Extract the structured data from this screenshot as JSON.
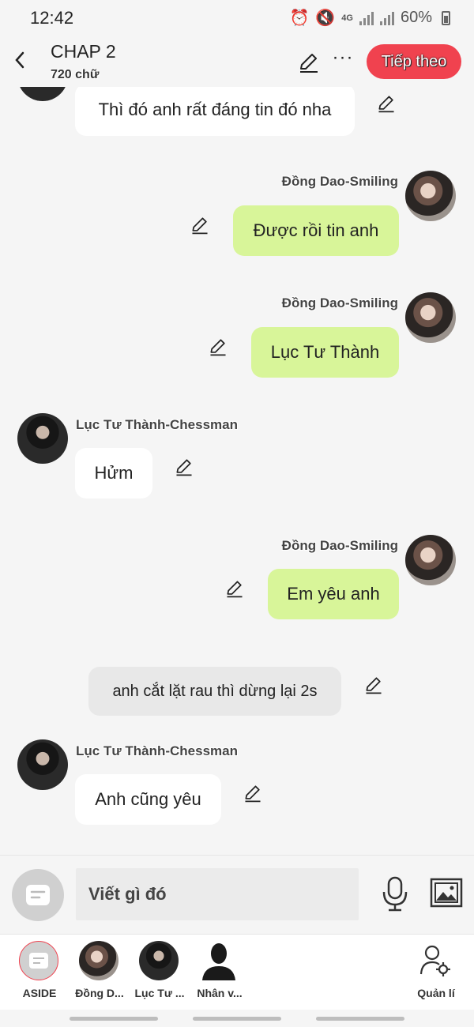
{
  "status_bar": {
    "time": "12:42",
    "network": "4G",
    "battery": "60%"
  },
  "header": {
    "title": "CHAP 2",
    "word_count": "720 chữ",
    "next_label": "Tiếp theo",
    "more_label": "···"
  },
  "messages": [
    {
      "side": "left",
      "sender": "",
      "text": "Thì đó anh rất đáng tin đó nha",
      "style": "white"
    },
    {
      "side": "right",
      "sender": "Đồng Dao-Smiling",
      "text": "Được rồi tin anh",
      "style": "green"
    },
    {
      "side": "right",
      "sender": "Đồng Dao-Smiling",
      "text": "Lục Tư Thành",
      "style": "green"
    },
    {
      "side": "left",
      "sender": "Lục Tư Thành-Chessman",
      "text": "Hửm",
      "style": "white"
    },
    {
      "side": "right",
      "sender": "Đồng Dao-Smiling",
      "text": "Em yêu anh",
      "style": "green"
    },
    {
      "side": "aside",
      "sender": "",
      "text": "anh cắt lặt rau thì dừng lại 2s",
      "style": "gray"
    },
    {
      "side": "left",
      "sender": "Lục Tư Thành-Chessman",
      "text": "Anh cũng yêu",
      "style": "white"
    }
  ],
  "input": {
    "placeholder": "Viết gì đó"
  },
  "bottom_nav": {
    "items": [
      {
        "label": "ASIDE",
        "icon": "aside-icon"
      },
      {
        "label": "Đồng D...",
        "icon": "avatar-girl"
      },
      {
        "label": "Lục Tư ...",
        "icon": "avatar-boy"
      },
      {
        "label": "Nhân v...",
        "icon": "person-silhouette-icon"
      },
      {
        "label": "Quản lí",
        "icon": "user-gear-icon"
      }
    ]
  },
  "colors": {
    "accent": "#f0424f",
    "my_bubble": "#d8f599",
    "their_bubble": "#ffffff",
    "aside_bubble": "#e8e8e8"
  }
}
